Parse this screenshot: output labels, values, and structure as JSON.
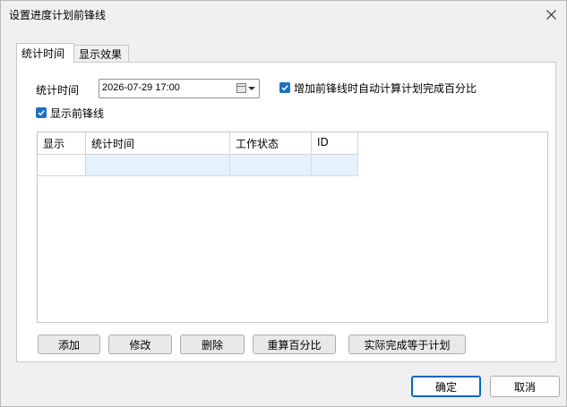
{
  "window": {
    "title": "设置进度计划前锋线",
    "close_icon": "close-icon"
  },
  "tabs": [
    {
      "label": "统计时间",
      "active": true
    },
    {
      "label": "显示效果",
      "active": false
    }
  ],
  "form": {
    "stat_time_label": "统计时间",
    "stat_time_value": "2026-07-29 17:00",
    "auto_calc_label": "增加前锋线时自动计算计划完成百分比",
    "auto_calc_checked": true,
    "show_line_label": "显示前锋线",
    "show_line_checked": true
  },
  "grid": {
    "columns": [
      "显示",
      "统计时间",
      "工作状态",
      "ID"
    ],
    "rows": [
      [
        "",
        "",
        "",
        ""
      ]
    ]
  },
  "actions": {
    "add": "添加",
    "edit": "修改",
    "delete": "删除",
    "recalc": "重算百分比",
    "actual_eq_plan": "实际完成等于计划"
  },
  "footer": {
    "ok": "确定",
    "cancel": "取消"
  },
  "colors": {
    "accent": "#1f6fc5",
    "selection": "#e5f1fb"
  }
}
